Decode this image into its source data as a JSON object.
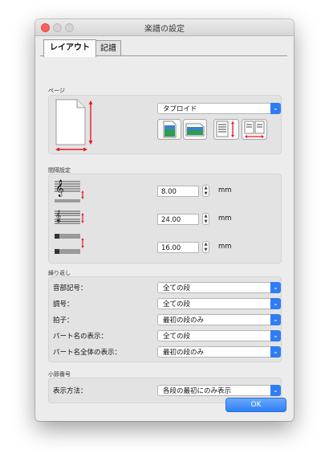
{
  "window": {
    "title": "楽譜の設定"
  },
  "tabs": [
    {
      "label": "レイアウト",
      "selected": true
    },
    {
      "label": "記譜",
      "selected": false
    }
  ],
  "page_section": {
    "label": "ページ",
    "size_select": "タブロイド",
    "buttons": [
      "portrait-icon",
      "landscape-icon",
      "page-height-icon",
      "page-width-icon"
    ]
  },
  "spacing_section": {
    "label": "間隔設定",
    "fields": [
      {
        "value": "8.00",
        "unit": "mm"
      },
      {
        "value": "24.00",
        "unit": "mm"
      },
      {
        "value": "16.00",
        "unit": "mm"
      }
    ]
  },
  "repeat_section": {
    "label": "繰り返し",
    "rows": [
      {
        "label": "音部記号：",
        "value": "全ての段"
      },
      {
        "label": "調号：",
        "value": "全ての段"
      },
      {
        "label": "拍子：",
        "value": "最初の段のみ"
      },
      {
        "label": "パート名の表示：",
        "value": "全ての段"
      },
      {
        "label": "パート名全体の表示：",
        "value": "最初の段のみ"
      }
    ]
  },
  "measure_section": {
    "label": "小節番号",
    "row": {
      "label": "表示方法：",
      "value": "各段の最初にのみ表示"
    }
  },
  "ok_label": "OK",
  "colors": {
    "accent": "#2f7df6",
    "marker": "#e8182a"
  }
}
